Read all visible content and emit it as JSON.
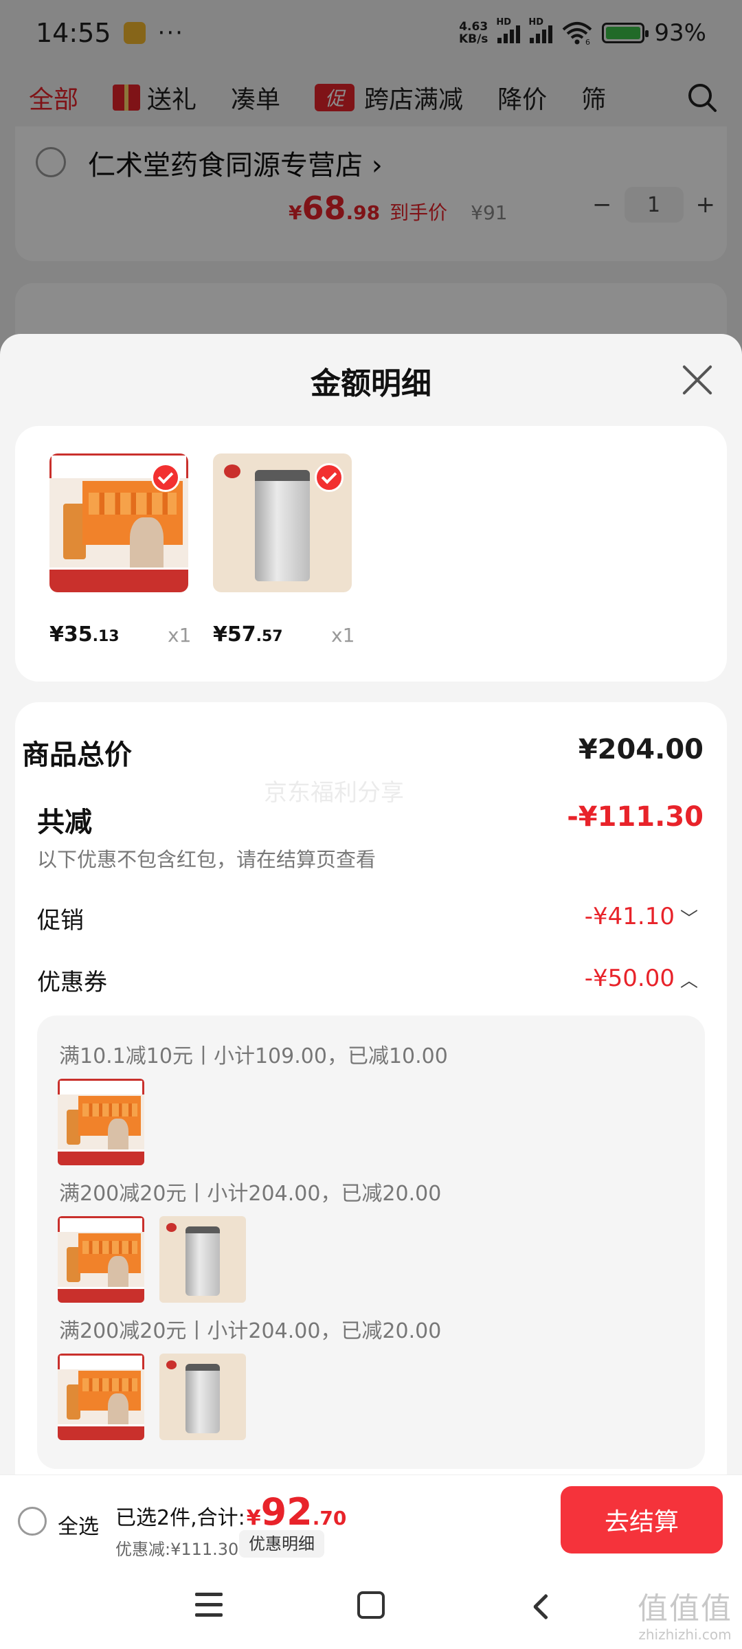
{
  "status": {
    "time": "14:55",
    "net_speed": "4.63 KB/s",
    "net_speed_value": "4.63",
    "net_speed_unit": "KB/s",
    "sim1": "HD",
    "sim2": "HD",
    "wifi_badge": "6",
    "battery": "93%",
    "more": "···"
  },
  "filters": {
    "all": "全部",
    "gift": "送礼",
    "bundle": "凑单",
    "promo_badge": "促",
    "cross_store": "跨店满减",
    "price_drop": "降价",
    "cut": "筛"
  },
  "cart_item": {
    "shop": "仁术堂药食同源专营店",
    "price_symbol": "¥",
    "price_int": "68",
    "price_dec": ".98",
    "price_tag": "到手价",
    "original_price": "¥91",
    "qty": "1",
    "minus": "−",
    "plus": "+"
  },
  "sheet": {
    "title": "金额明细",
    "products": [
      {
        "price_int": "¥35",
        "price_dec": ".13",
        "count": "x1"
      },
      {
        "price_int": "¥57",
        "price_dec": ".57",
        "count": "x1"
      }
    ],
    "total_label": "商品总价",
    "total_value": "¥204.00",
    "reduce_label": "共减",
    "reduce_value": "-¥111.30",
    "note": "以下优惠不包含红包，请在结算页查看",
    "promo_label": "促销",
    "promo_value": "-¥41.10",
    "coupon_label": "优惠券",
    "coupon_value": "-¥50.00",
    "watermark": "京东福利分享",
    "coupons": [
      {
        "text": "满10.1减10元丨小计109.00，已减10.00"
      },
      {
        "text": "满200减20元丨小计204.00，已减20.00"
      },
      {
        "text": "满200减20元丨小计204.00，已减20.00"
      }
    ]
  },
  "bottom": {
    "select_all": "全选",
    "selected_text": "已选2件,合计:",
    "currency": "¥",
    "total_int": "92",
    "total_dec": ".70",
    "discount": "优惠减:¥111.30",
    "detail_chip": "优惠明细",
    "checkout": "去结算"
  },
  "corner_mark": {
    "logo": "值值值",
    "url": "zhizhizhi.com"
  },
  "colors": {
    "accent": "#e8232a",
    "checkout": "#f5333b"
  }
}
